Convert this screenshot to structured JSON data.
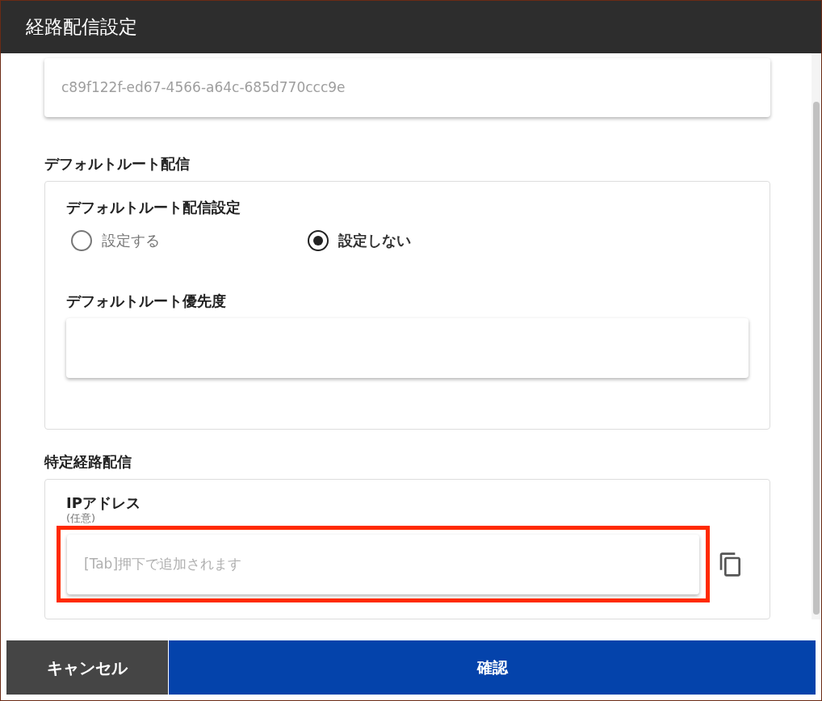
{
  "window": {
    "title": "経路配信設定"
  },
  "id_field": {
    "value": "c89f122f-ed67-4566-a64c-685d770ccc9e",
    "disabled": true
  },
  "default_route": {
    "heading": "デフォルトルート配信",
    "setting_label": "デフォルトルート配信設定",
    "options": [
      {
        "label": "設定する",
        "selected": false
      },
      {
        "label": "設定しない",
        "selected": true
      }
    ],
    "priority_label": "デフォルトルート優先度"
  },
  "specific_route": {
    "heading": "特定経路配信",
    "ip_label": "IPアドレス",
    "ip_note": "(任意)",
    "ip_placeholder": "[Tab]押下で追加されます",
    "highlighted": true
  },
  "buttons": {
    "cancel": "キャンセル",
    "confirm": "確認"
  }
}
